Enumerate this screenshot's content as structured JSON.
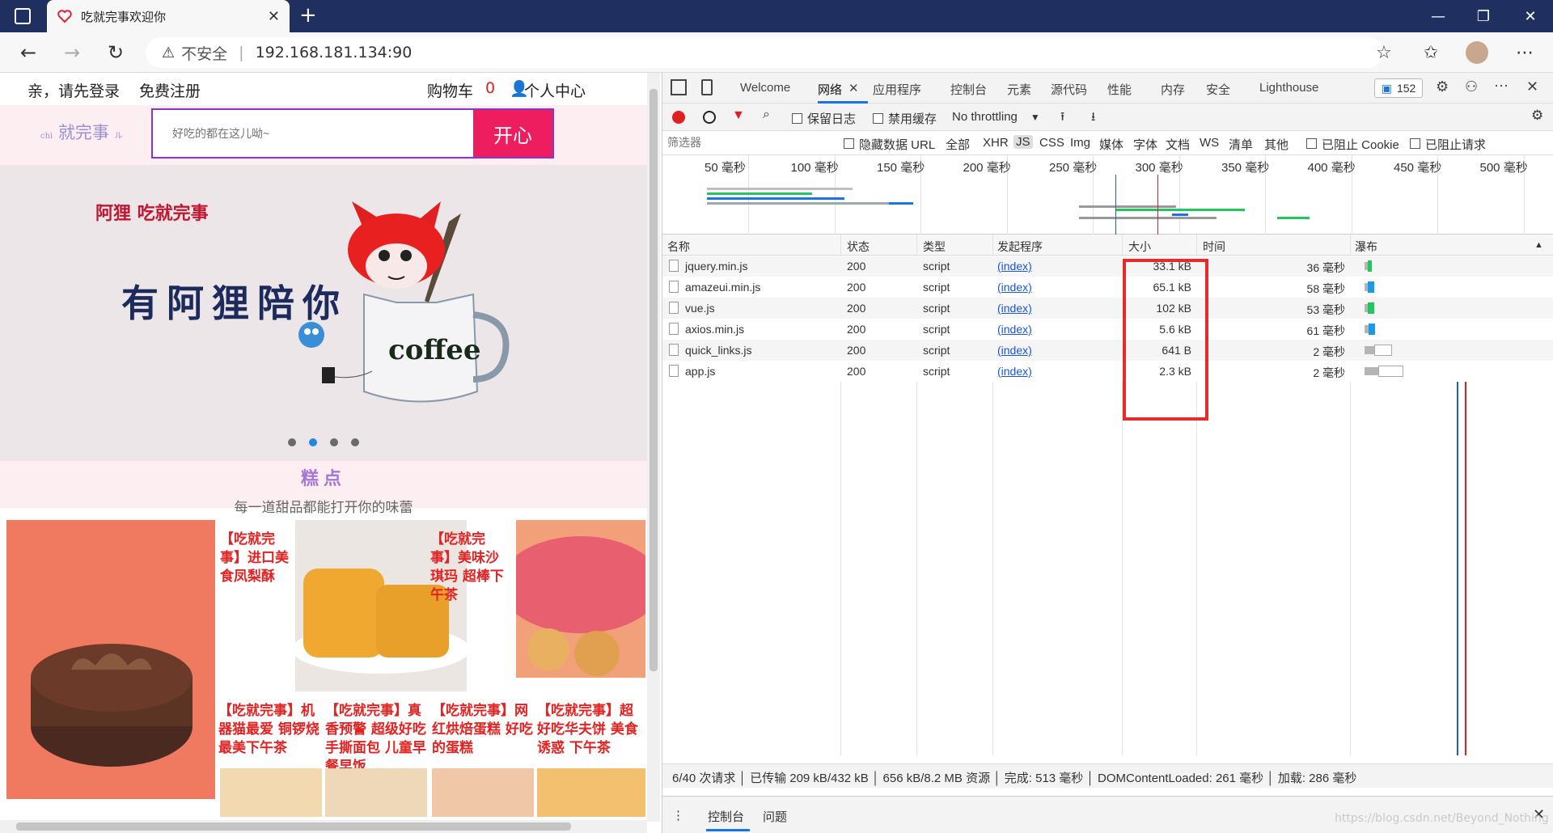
{
  "browser": {
    "tab_title": "吃就完事欢迎你",
    "new_tab": "+",
    "url_warning": "不安全",
    "url_separator": "|",
    "url": "192.168.181.134:90"
  },
  "page": {
    "header": {
      "login": "亲，请先登录",
      "register": "免费注册",
      "cart_label": "购物车",
      "cart_count": "0",
      "user_center": "个人中心"
    },
    "logo_prefix": "chi",
    "logo_text": "就完事",
    "logo_suffix": "ル",
    "search": {
      "placeholder": "好吃的都在这儿呦~",
      "button": "开心"
    },
    "banner": {
      "brand": "阿狸 吃就完事",
      "slogan": "有阿狸陪你",
      "cup_text": "coffee",
      "slides": 4,
      "active_slide": 2
    },
    "section": {
      "title": "糕点",
      "subtitle": "每一道甜品都能打开你的味蕾"
    },
    "products": [
      {
        "caption": "【吃就完事】进口美食凤梨酥"
      },
      {
        "caption": "【吃就完事】美味沙琪玛 超棒下午茶"
      },
      {
        "caption": "【吃就完事】机器猫最爱 铜锣烧 最美下午茶"
      },
      {
        "caption": "【吃就完事】真香预警 超级好吃 手撕面包 儿童早餐早饭"
      },
      {
        "caption": "【吃就完事】网红烘焙蛋糕 好吃的蛋糕"
      },
      {
        "caption": "【吃就完事】超好吃华夫饼 美食诱惑 下午茶"
      }
    ]
  },
  "devtools": {
    "tabs": [
      "Welcome",
      "网络",
      "应用程序",
      "控制台",
      "元素",
      "源代码",
      "性能",
      "内存",
      "安全",
      "Lighthouse"
    ],
    "active_tab": "网络",
    "issues_count": "152",
    "toolbar": {
      "preserve_log": "保留日志",
      "disable_cache": "禁用缓存",
      "throttling": "No throttling"
    },
    "filter": {
      "placeholder": "筛选器",
      "hide_data_url": "隐藏数据 URL",
      "types": [
        "全部",
        "XHR",
        "JS",
        "CSS",
        "Img",
        "媒体",
        "字体",
        "文档",
        "WS",
        "清单",
        "其他"
      ],
      "active_type": "JS",
      "blocked_cookies": "已阻止 Cookie",
      "blocked_requests": "已阻止请求"
    },
    "overview_ticks": [
      "50 毫秒",
      "100 毫秒",
      "150 毫秒",
      "200 毫秒",
      "250 毫秒",
      "300 毫秒",
      "350 毫秒",
      "400 毫秒",
      "450 毫秒",
      "500 毫秒"
    ],
    "columns": {
      "name": "名称",
      "status": "状态",
      "type": "类型",
      "initiator": "发起程序",
      "size": "大小",
      "time": "时间",
      "waterfall": "瀑布"
    },
    "rows": [
      {
        "name": "jquery.min.js",
        "status": "200",
        "type": "script",
        "initiator": "(index)",
        "size": "33.1 kB",
        "time": "36 毫秒",
        "wf_start": 0.05,
        "wf_len": 0.03
      },
      {
        "name": "amazeui.min.js",
        "status": "200",
        "type": "script",
        "initiator": "(index)",
        "size": "65.1 kB",
        "time": "58 毫秒",
        "wf_start": 0.05,
        "wf_len": 0.05
      },
      {
        "name": "vue.js",
        "status": "200",
        "type": "script",
        "initiator": "(index)",
        "size": "102 kB",
        "time": "53 毫秒",
        "wf_start": 0.05,
        "wf_len": 0.05
      },
      {
        "name": "axios.min.js",
        "status": "200",
        "type": "script",
        "initiator": "(index)",
        "size": "5.6 kB",
        "time": "61 毫秒",
        "wf_start": 0.05,
        "wf_len": 0.055
      },
      {
        "name": "quick_links.js",
        "status": "200",
        "type": "script",
        "initiator": "(index)",
        "size": "641 B",
        "time": "2 毫秒",
        "wf_start": 0.05,
        "wf_len": 0.14
      },
      {
        "name": "app.js",
        "status": "200",
        "type": "script",
        "initiator": "(index)",
        "size": "2.3 kB",
        "time": "2 毫秒",
        "wf_start": 0.05,
        "wf_len": 0.2
      }
    ],
    "status_bar": "6/40 次请求 │ 已传输 209 kB/432 kB │ 656 kB/8.2 MB 资源 │ 完成: 513 毫秒 │ DOMContentLoaded: 261 毫秒 │ 加载: 286 毫秒",
    "drawer": {
      "more": "⋮",
      "console": "控制台",
      "issues": "问题"
    }
  },
  "watermark": "https://blog.csdn.net/Beyond_Nothing",
  "colors": {
    "accent_blue": "#1a73e8",
    "highlight_red": "#e52b2b",
    "search_pink": "#ee1d5f",
    "titlebar": "#1f3060"
  }
}
